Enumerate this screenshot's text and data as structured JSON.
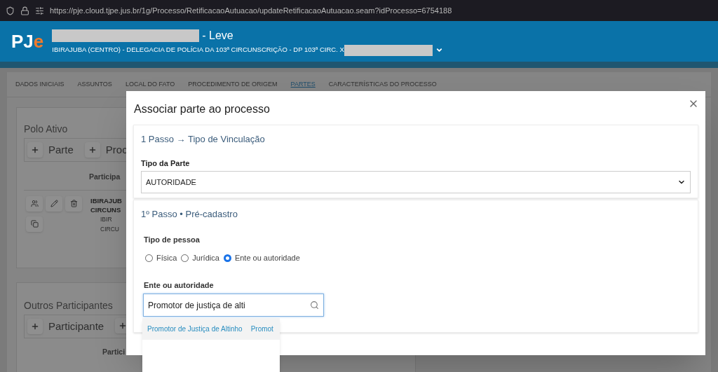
{
  "browser": {
    "url": "https://pje.cloud.tjpe.jus.br/1g/Processo/RetificacaoAutuacao/updateRetificacaoAutuacao.seam?idProcesso=6754188"
  },
  "header": {
    "logo": {
      "main": "PJ",
      "accent": "e"
    },
    "title": "- Leve",
    "subtitle": "IBIRAJUBA (CENTRO) - DELEGACIA DE POLÍCIA DA 103ª CIRCUNSCRIÇÃO - DP 103ª CIRC. X"
  },
  "tabs": [
    {
      "label": "DADOS INICIAIS",
      "selected": false
    },
    {
      "label": "ASSUNTOS",
      "selected": false
    },
    {
      "label": "LOCAL DO FATO",
      "selected": false
    },
    {
      "label": "PROCEDIMENTO DE ORIGEM",
      "selected": false
    },
    {
      "label": "PARTES",
      "selected": true
    },
    {
      "label": "CARACTERÍSTICAS DO PROCESSO",
      "selected": false
    }
  ],
  "polo_ativo": {
    "title": "Polo Ativo",
    "buttons": [
      {
        "label": "Parte"
      },
      {
        "label": "Proc"
      }
    ],
    "column": "Participa",
    "participant": {
      "name_lines": [
        "IBIRAJUB",
        "CIRCUNS"
      ],
      "sub_lines": [
        "IBIR",
        "CIRCU"
      ]
    }
  },
  "outros": {
    "title": "Outros Participantes",
    "buttons": [
      {
        "label": "Participante"
      },
      {
        "kind": "icon"
      }
    ],
    "column": "Partici"
  },
  "modal": {
    "title": "Associar parte ao processo",
    "step1": {
      "title": "1 Passo → Tipo de Vinculação",
      "label": "Tipo da Parte",
      "value": "AUTORIDADE"
    },
    "step2": {
      "title": "1º Passo • Pré-cadastro",
      "person_label": "Tipo de pessoa",
      "person_options": [
        {
          "label": "Física",
          "selected": false
        },
        {
          "label": "Jurídica",
          "selected": false
        },
        {
          "label": "Ente ou autoridade",
          "selected": true
        }
      ],
      "entity_label": "Ente ou autoridade",
      "entity_value": "Promotor de justiça de alti",
      "suggestions": [
        {
          "columns": [
            "Promotor de Justiça de Altinho",
            "Promot"
          ]
        }
      ]
    }
  }
}
